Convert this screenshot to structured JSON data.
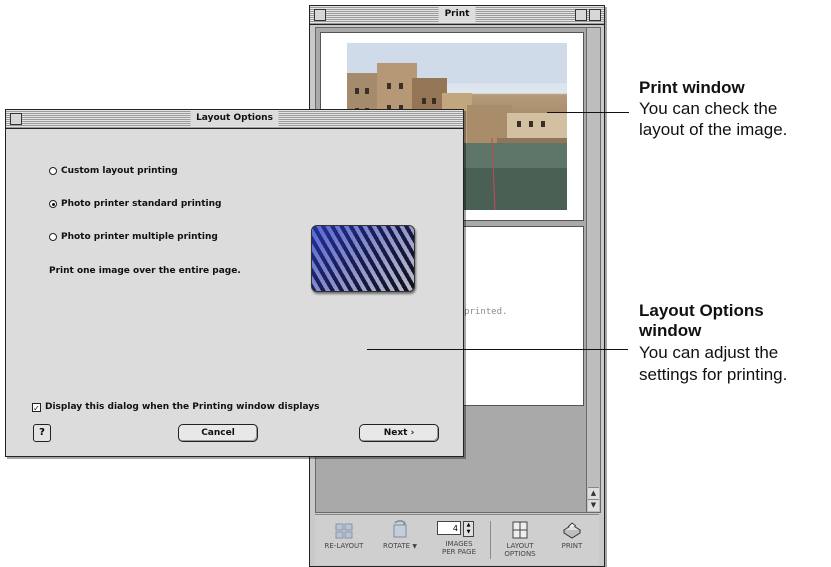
{
  "print_window": {
    "title": "Print",
    "empty_page_text": "t be printed.",
    "toolbar": {
      "relayout_label": "RE-LAYOUT",
      "rotate_label": "ROTATE",
      "images_per_page_value": "4",
      "images_per_page_line1": "IMAGES",
      "images_per_page_line2": "PER PAGE",
      "layout_options_line1": "LAYOUT",
      "layout_options_line2": "OPTIONS",
      "print_label": "PRINT"
    }
  },
  "layout_window": {
    "title": "Layout Options",
    "options": [
      {
        "label": "Custom layout printing",
        "selected": false
      },
      {
        "label": "Photo printer standard printing",
        "selected": true
      },
      {
        "label": "Photo printer multiple printing",
        "selected": false
      }
    ],
    "description": "Print one image over the entire page.",
    "display_checkbox_label": "Display this dialog when the Printing window displays",
    "display_checkbox_checked": true,
    "help_label": "?",
    "cancel_label": "Cancel",
    "next_label": "Next ›"
  },
  "callouts": {
    "print_title": "Print window",
    "print_line1": "You can check the",
    "print_line2": "layout of the image.",
    "layout_title_line1": "Layout Options",
    "layout_title_line2": "window",
    "layout_line1": "You can adjust the",
    "layout_line2": "settings for printing."
  }
}
